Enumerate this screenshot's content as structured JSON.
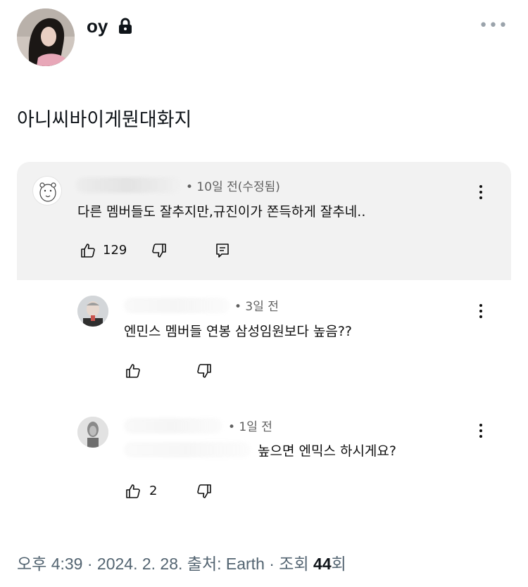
{
  "header": {
    "username": "oy",
    "more_icon": "more-dots-icon",
    "lock_icon": "lock-icon"
  },
  "post": {
    "text": "아니씨바이게뭔대화지"
  },
  "comments": [
    {
      "meta": "• 10일 전(수정됨)",
      "text": "다른 멤버들도 잘추지만,규진이가 쫀득하게 잘추네..",
      "likes": "129"
    },
    {
      "meta": "• 3일 전",
      "text": "엔민스 멤버들 연봉 삼성임원보다 높음??",
      "likes": ""
    },
    {
      "meta": "• 1일 전",
      "text": "높으면 엔믹스 하시게요?",
      "likes": "2"
    }
  ],
  "footer": {
    "time": "오후 4:39 · 2024. 2. 28. 출처: Earth · 조회 ",
    "views": "44",
    "suffix": "회"
  }
}
